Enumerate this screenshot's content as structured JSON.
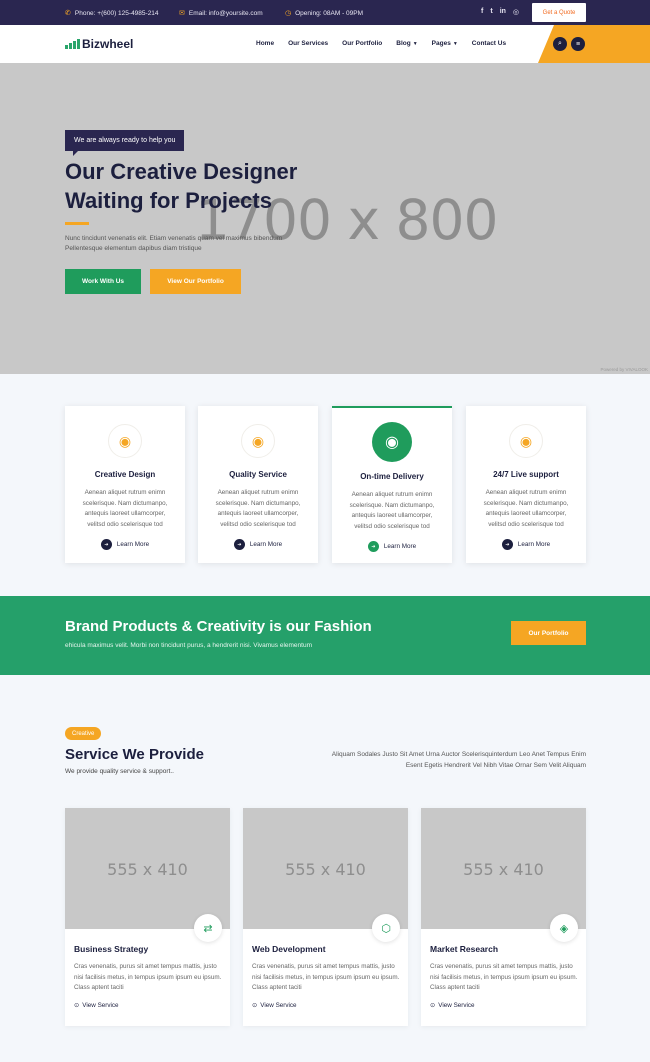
{
  "topbar": {
    "phone": "Phone: +(600) 125-4985-214",
    "email": "Email: info@yoursite.com",
    "opening": "Opening: 08AM - 09PM",
    "social_icons": [
      "facebook-icon",
      "twitter-icon",
      "linkedin-icon",
      "instagram-icon"
    ],
    "quote_label": "Get a Quote"
  },
  "nav": {
    "brand": "Bizwheel",
    "items": [
      {
        "label": "Home",
        "caret": false
      },
      {
        "label": "Our Services",
        "caret": false
      },
      {
        "label": "Our Portfolio",
        "caret": false
      },
      {
        "label": "Blog",
        "caret": true
      },
      {
        "label": "Pages",
        "caret": true
      },
      {
        "label": "Contact Us",
        "caret": false
      }
    ]
  },
  "hero": {
    "tag": "We are always ready to help you",
    "title": "Our Creative Designer Waiting for Projects",
    "description": "Nunc tincidunt venenatis elit. Etiam venenatis quam vel maximus bibendum Pellentesque elementum dapibus diam tristique",
    "primary_button": "Work With Us",
    "secondary_button": "View Our Portfolio",
    "placeholder": "1700 x 800",
    "powered": "Powered by VIVALOOK"
  },
  "features": {
    "more_label": "Learn More",
    "items": [
      {
        "title": "Creative Design",
        "desc": "Aenean aliquet rutrum enimn scelerisque. Nam dictumanpo, antequis laoreet ullamcorper, velitsd odio scelerisque tod",
        "active": false
      },
      {
        "title": "Quality Service",
        "desc": "Aenean aliquet rutrum enimn scelerisque. Nam dictumanpo, antequis laoreet ullamcorper, velitsd odio scelerisque tod",
        "active": false
      },
      {
        "title": "On-time Delivery",
        "desc": "Aenean aliquet rutrum enimn scelerisque. Nam dictumanpo, antequis laoreet ullamcorper, velitsd odio scelerisque tod",
        "active": true
      },
      {
        "title": "24/7 Live support",
        "desc": "Aenean aliquet rutrum enimn scelerisque. Nam dictumanpo, antequis laoreet ullamcorper, velitsd odio scelerisque tod",
        "active": false
      }
    ]
  },
  "banner": {
    "title": "Brand Products & Creativity is our Fashion",
    "subtitle": "ehicula maximus velit. Morbi non tincidunt purus, a hendrerit nisi. Vivamus elementum",
    "button": "Our Portfolio"
  },
  "services": {
    "pill": "Creative",
    "title": "Service We Provide",
    "subtitle": "We provide quality service & support..",
    "intro": "Aliquam Sodales Justo Sit Amet Urna Auctor Scelerisquinterdum Leo Anet Tempus Enim Esent Egetis Hendrerit Vel Nibh Vitae Ornar Sem Velit Aliquam",
    "link_label": "View Service",
    "cards": [
      {
        "title": "Business Strategy",
        "desc": "Cras venenatis, purus sit amet tempus mattis, justo nisi facilisis metus, in tempus ipsum ipsum eu ipsum. Class aptent taciti",
        "placeholder": "555 x 410",
        "icon": "handshake-icon"
      },
      {
        "title": "Web Development",
        "desc": "Cras venenatis, purus sit amet tempus mattis, justo nisi facilisis metus, in tempus ipsum ipsum eu ipsum. Class aptent taciti",
        "placeholder": "555 x 410",
        "icon": "html5-icon"
      },
      {
        "title": "Market Research",
        "desc": "Cras venenatis, purus sit amet tempus mattis, justo nisi facilisis metus, in tempus ipsum ipsum eu ipsum. Class aptent taciti",
        "placeholder": "555 x 410",
        "icon": "cube-icon"
      }
    ]
  },
  "colors": {
    "navy": "#2a2650",
    "green": "#1f9c5c",
    "orange": "#f5a623"
  }
}
